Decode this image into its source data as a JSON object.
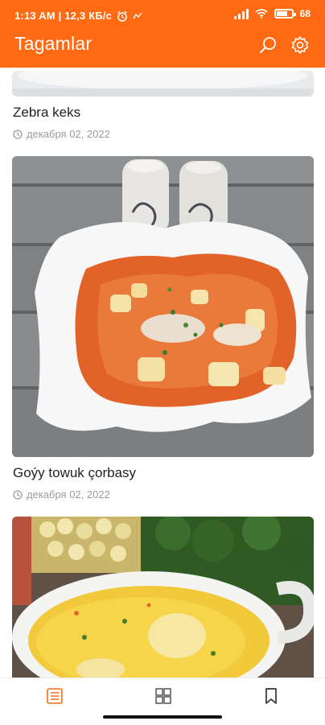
{
  "status_bar": {
    "time_info": "1:13 AM | 12,3 КБ/с",
    "battery": "68"
  },
  "app_bar": {
    "title": "Tagamlar",
    "icons": [
      "search-icon",
      "gear-icon"
    ]
  },
  "feed": {
    "items": [
      {
        "title": "Zebra keks",
        "date": "декабря 02, 2022"
      },
      {
        "title": "Goýy towuk çorbasy",
        "date": "декабря 02, 2022"
      },
      {
        "title": "",
        "date": ""
      }
    ]
  },
  "bottom_nav": {
    "items": [
      "list-icon",
      "grid-icon",
      "bookmark-icon"
    ],
    "active_color": "#ff6a13"
  },
  "colors": {
    "accent": "#ff6a13",
    "text_secondary": "#9c9c9c"
  }
}
